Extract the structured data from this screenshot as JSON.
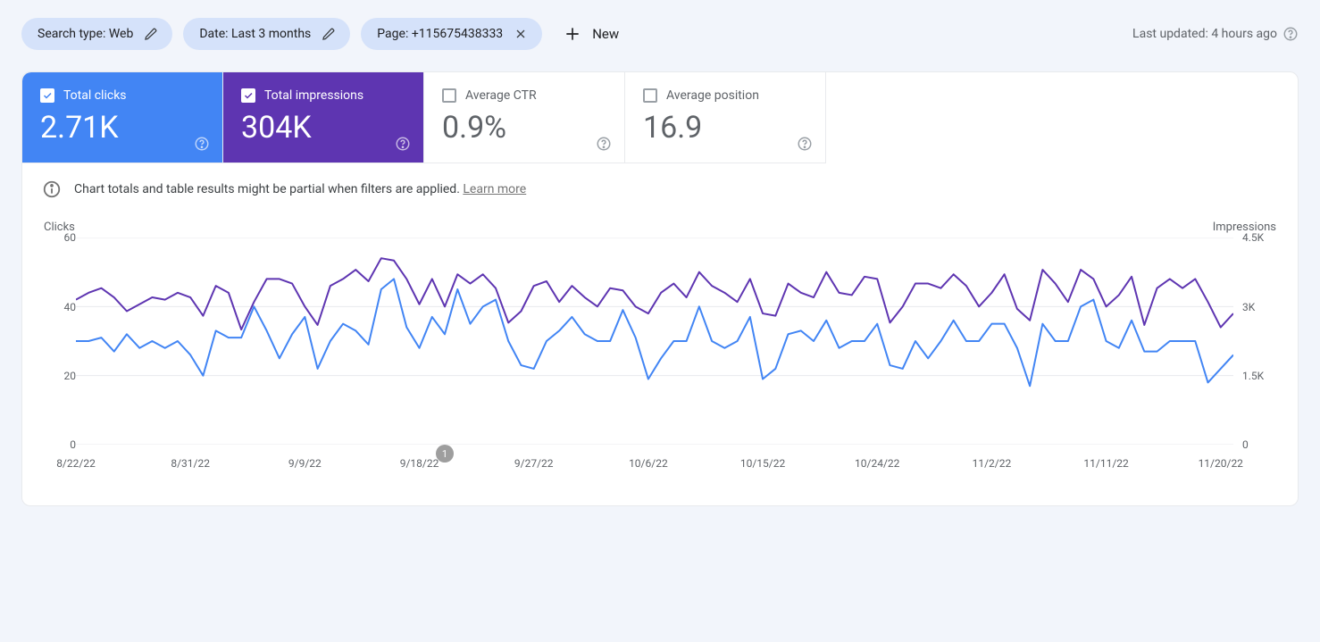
{
  "filters": {
    "search_type": {
      "label": "Search type: Web"
    },
    "date": {
      "label": "Date: Last 3 months"
    },
    "page": {
      "label": "Page: +115675438333"
    },
    "new_label": "New"
  },
  "last_updated": "Last updated: 4 hours ago",
  "metrics": {
    "clicks": {
      "label": "Total clicks",
      "value": "2.71K",
      "checked": true
    },
    "impressions": {
      "label": "Total impressions",
      "value": "304K",
      "checked": true
    },
    "ctr": {
      "label": "Average CTR",
      "value": "0.9%",
      "checked": false
    },
    "position": {
      "label": "Average position",
      "value": "16.9",
      "checked": false
    }
  },
  "banner": {
    "text": "Chart totals and table results might be partial when filters are applied. ",
    "link": "Learn more"
  },
  "chart_data": {
    "type": "line",
    "left_axis_title": "Clicks",
    "right_axis_title": "Impressions",
    "left_ticks": [
      60,
      40,
      20,
      0
    ],
    "right_ticks": [
      "4.5K",
      "3K",
      "1.5K",
      0
    ],
    "y_left_range": [
      0,
      60
    ],
    "y_right_range": [
      0,
      4500
    ],
    "x_tick_labels": [
      "8/22/22",
      "8/31/22",
      "9/9/22",
      "9/18/22",
      "9/27/22",
      "10/6/22",
      "10/15/22",
      "10/24/22",
      "11/2/22",
      "11/11/22",
      "11/20/22"
    ],
    "x_tick_indices": [
      0,
      9,
      18,
      27,
      36,
      45,
      54,
      63,
      72,
      81,
      90
    ],
    "event_marker": {
      "index": 29,
      "label": "1"
    },
    "colors": {
      "clicks": "#4285f4",
      "impressions": "#5e35b1",
      "grid": "#e8eaed"
    },
    "series": [
      {
        "name": "Clicks",
        "axis": "left",
        "values": [
          30,
          30,
          31,
          27,
          32,
          28,
          30,
          28,
          30,
          26,
          20,
          33,
          31,
          31,
          40,
          33,
          25,
          32,
          37,
          22,
          30,
          35,
          33,
          29,
          45,
          48,
          34,
          28,
          37,
          32,
          45,
          35,
          40,
          42,
          30,
          23,
          22,
          30,
          33,
          37,
          32,
          30,
          30,
          39,
          31,
          19,
          25,
          30,
          30,
          40,
          30,
          28,
          30,
          37,
          19,
          22,
          32,
          33,
          30,
          36,
          28,
          30,
          30,
          35,
          23,
          22,
          30,
          25,
          30,
          36,
          30,
          30,
          35,
          35,
          28,
          17,
          35,
          30,
          30,
          40,
          42,
          30,
          28,
          36,
          27,
          27,
          30,
          30,
          30,
          18,
          22,
          26
        ]
      },
      {
        "name": "Impressions",
        "axis": "right",
        "values": [
          3150,
          3300,
          3400,
          3200,
          2900,
          3050,
          3200,
          3150,
          3300,
          3200,
          2800,
          3450,
          3300,
          2500,
          3100,
          3600,
          3600,
          3500,
          3000,
          2600,
          3450,
          3600,
          3800,
          3550,
          4050,
          4000,
          3600,
          3050,
          3600,
          3000,
          3700,
          3500,
          3700,
          3400,
          2650,
          2900,
          3450,
          3550,
          3100,
          3450,
          3200,
          3000,
          3400,
          3350,
          3000,
          2850,
          3300,
          3500,
          3200,
          3750,
          3450,
          3300,
          3100,
          3600,
          2850,
          2800,
          3500,
          3300,
          3200,
          3750,
          3300,
          3250,
          3650,
          3600,
          2650,
          3000,
          3500,
          3500,
          3400,
          3700,
          3450,
          3000,
          3300,
          3700,
          2950,
          2700,
          3800,
          3500,
          3100,
          3800,
          3600,
          3000,
          3250,
          3650,
          2600,
          3400,
          3600,
          3400,
          3600,
          3100,
          2550,
          2850
        ]
      }
    ]
  }
}
